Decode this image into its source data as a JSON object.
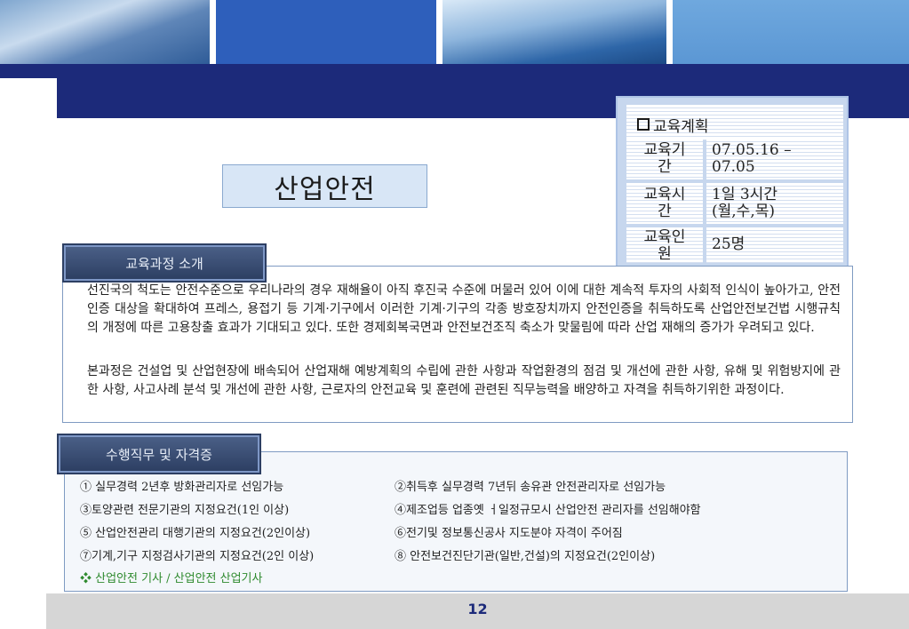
{
  "title": "산업안전",
  "plan": {
    "header": "교육계획",
    "rows": [
      {
        "key": "교육기\n간",
        "value": "07.05.16 –\n07.05"
      },
      {
        "key": "교육시\n간",
        "value": "1일 3시간\n(월,수,목)"
      },
      {
        "key": "교육인\n원",
        "value": "25명"
      }
    ]
  },
  "intro": {
    "tab": "교육과정 소개",
    "p1": "선진국의 척도는 안전수준으로 우리나라의 경우 재해율이 아직 후진국 수준에 머물러 있어 이에 대한 계속적 투자의 사회적 인식이 높아가고, 안전인증 대상을 확대하여 프레스, 용접기 등 기계·기구에서 이러한 기계·기구의 각종 방호장치까지 안전인증을 취득하도록 산업안전보건법 시행규칙의 개정에 따른 고용창출 효과가 기대되고 있다. 또한 경제회복국면과 안전보건조직 축소가 맞물림에 따라 산업 재해의 증가가 우려되고 있다.",
    "p2": "본과정은 건설업 및 산업현장에 배속되어 산업재해 예방계획의 수립에 관한 사항과 작업환경의 점검 및 개선에 관한 사항, 유해 및 위험방지에 관한 사항, 사고사례 분석 및 개선에 관한 사항, 근로자의 안전교육 및 훈련에 관련된 직무능력을 배양하고 자격을 취득하기위한 과정이다."
  },
  "duties": {
    "tab": "수행직무 및 자격증",
    "left": [
      "① 실무경력 2년후 방화관리자로 선임가능",
      "③토양관련 전문기관의 지정요건(1인 이상)",
      "⑤ 산업안전관리 대행기관의 지정요건(2인이상)",
      "⑦기계,기구 지정검사기관의 지정요건(2인 이상)"
    ],
    "right": [
      "②취득후 실무경력 7년뒤 송유관 안전관리자로 선임가능",
      "④제조업등 업종옛 ㅓ일정규모시 산업안전 관리자를 선임해야함",
      "⑥전기및 정보통신공사 지도분야 자격이 주어짐",
      "⑧ 안전보건진단기관(일반,건설)의 지정요건(2인이상)"
    ],
    "cert": "❖ 산업안전 기사 / 산업안전 산업기사"
  },
  "page_number": "12",
  "colors": {
    "band": "#1c2a7a",
    "tab": "#2d3f63",
    "cert": "#2e8a2e"
  }
}
